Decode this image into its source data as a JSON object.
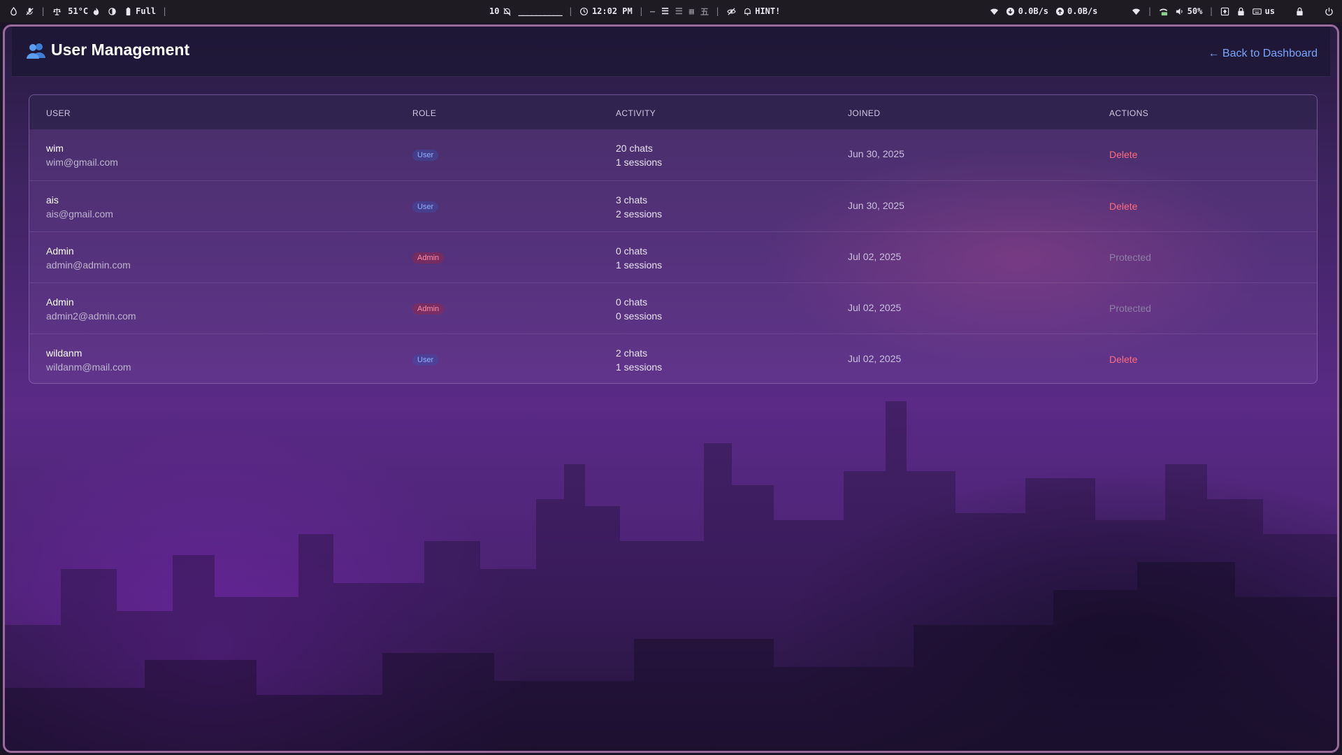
{
  "topbar": {
    "temperature": "51°C",
    "battery_label": "Full",
    "workspace_number": "10",
    "workspace_bar": "__________",
    "time": "12:02 PM",
    "hint_label": "HINT!",
    "net_down": "0.0B/s",
    "net_up": "0.0B/s",
    "volume": "50%",
    "keyboard_layout": "us",
    "icons": [
      "water-drop-icon",
      "mic-off-icon",
      "scale-icon",
      "flame-icon",
      "contrast-icon",
      "battery-icon",
      "bell-off-icon",
      "clock-icon",
      "eye-off-icon",
      "bell-icon",
      "wifi-icon",
      "download-icon",
      "upload-icon",
      "wifi-signal-icon",
      "volume-icon",
      "keyboard-icon",
      "lock-icon",
      "power-icon"
    ]
  },
  "header": {
    "title": "User Management",
    "back_link": "← Back to Dashboard"
  },
  "table": {
    "columns": [
      "USER",
      "ROLE",
      "ACTIVITY",
      "JOINED",
      "ACTIONS"
    ],
    "rows": [
      {
        "name": "wim",
        "email": "wim@gmail.com",
        "role": "User",
        "chats": "20 chats",
        "sessions": "1 sessions",
        "joined": "Jun 30, 2025",
        "action": "Delete"
      },
      {
        "name": "ais",
        "email": "ais@gmail.com",
        "role": "User",
        "chats": "3 chats",
        "sessions": "2 sessions",
        "joined": "Jun 30, 2025",
        "action": "Delete"
      },
      {
        "name": "Admin",
        "email": "admin@admin.com",
        "role": "Admin",
        "chats": "0 chats",
        "sessions": "1 sessions",
        "joined": "Jul 02, 2025",
        "action": "Protected"
      },
      {
        "name": "Admin",
        "email": "admin2@admin.com",
        "role": "Admin",
        "chats": "0 chats",
        "sessions": "0 sessions",
        "joined": "Jul 02, 2025",
        "action": "Protected"
      },
      {
        "name": "wildanm",
        "email": "wildanm@mail.com",
        "role": "User",
        "chats": "2 chats",
        "sessions": "1 sessions",
        "joined": "Jul 02, 2025",
        "action": "Delete"
      }
    ]
  },
  "colors": {
    "accent_link": "#7aa5ff",
    "delete": "#ff6b7e",
    "protected": "#8e7fa8",
    "user_badge": "#8fb0ff",
    "admin_badge": "#ff8fa3",
    "window_border": "#9a6c9b"
  }
}
